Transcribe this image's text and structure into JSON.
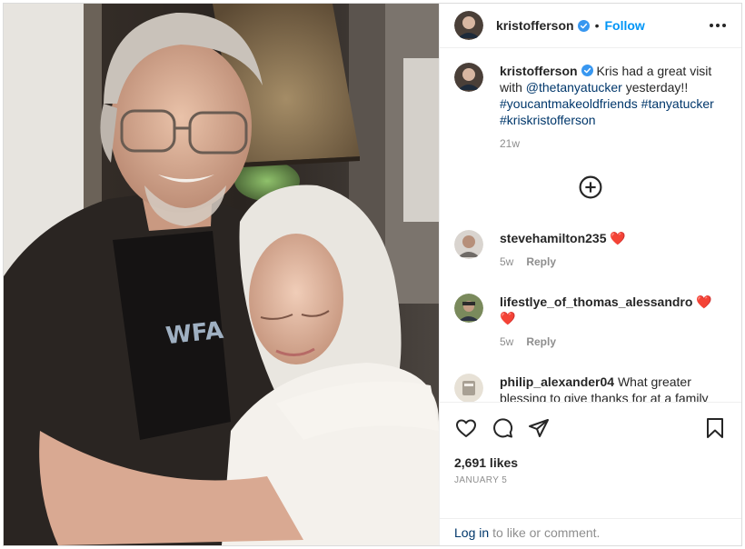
{
  "post": {
    "author": "kristofferson",
    "follow_label": "Follow",
    "separator": "•"
  },
  "caption": {
    "username": "kristofferson",
    "text_before": "Kris had a great visit with ",
    "mention": "@thetanyatucker",
    "text_middle": " yesterday!! ",
    "hashtag1": "#youcantmakeoldfriends",
    "hashtag2": "#tanyatucker",
    "hashtag3": "#kriskristofferson",
    "time": "21w"
  },
  "comments": [
    {
      "username": "stevehamilton235",
      "text": "",
      "emoji": "❤️",
      "time": "5w",
      "reply_label": "Reply"
    },
    {
      "username": "lifestlye_of_thomas_alessandro",
      "text": "",
      "emoji": "❤️❤️",
      "time": "5w",
      "reply_label": "Reply"
    },
    {
      "username": "philip_alexander04",
      "text": "What greater blessing to give thanks for at a family gathering than the family and the gathering.",
      "emoji": "",
      "time": "",
      "reply_label": ""
    }
  ],
  "engagement": {
    "likes": "2,691 likes",
    "date": "JANUARY 5"
  },
  "login": {
    "link_label": "Log in",
    "rest": "to like or comment."
  },
  "icons": {
    "like": "heart-icon",
    "comment": "comment-bubble-icon",
    "share": "paper-plane-icon",
    "save": "bookmark-icon",
    "more": "more-options-icon",
    "load_more": "plus-circle-icon",
    "verified": "verified-badge-icon"
  },
  "colors": {
    "accent": "#0095f6",
    "link": "#00376b",
    "verified": "#3897f0",
    "secondary_text": "#8e8e8e",
    "divider": "#efefef"
  }
}
